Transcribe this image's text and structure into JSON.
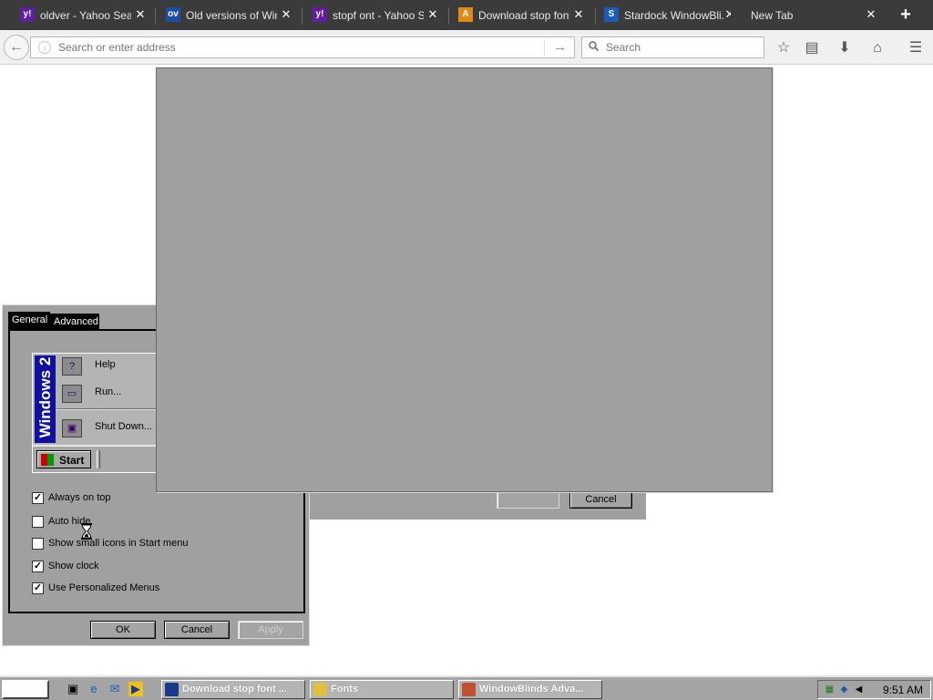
{
  "browser": {
    "tabs": [
      {
        "title": "oldver - Yahoo Sear...",
        "favicon": "yahoo-icon",
        "favicon_text": "y!",
        "favicon_color": "#5f1fa0"
      },
      {
        "title": "Old versions of Win...",
        "favicon": "oldversion-icon",
        "favicon_text": "ov",
        "favicon_color": "#1d4fa0"
      },
      {
        "title": "stopf ont - Yahoo S...",
        "favicon": "yahoo-icon",
        "favicon_text": "y!",
        "favicon_color": "#5f1fa0"
      },
      {
        "title": "Download stop font ...",
        "favicon": "download-icon",
        "favicon_text": "A",
        "favicon_color": "#e08a1a"
      },
      {
        "title": "Stardock WindowBli...",
        "favicon": "stardock-icon",
        "favicon_text": "S",
        "favicon_color": "#1a5bb8"
      },
      {
        "title": "New Tab",
        "favicon": "",
        "favicon_text": "",
        "favicon_color": ""
      }
    ],
    "url_placeholder": "Search or enter address",
    "search_placeholder": "Search",
    "colors": {
      "tab_strip": "#3b3b3b",
      "navbar": "#f0f0f0"
    }
  },
  "dialog": {
    "tabs": {
      "general": "General",
      "advanced": "Advanced"
    },
    "banner_text": "Windows 2",
    "start_menu": {
      "items": [
        {
          "label": "Help",
          "icon": "help-book-icon"
        },
        {
          "label": "Run...",
          "icon": "run-icon"
        },
        {
          "label": "Shut Down...",
          "icon": "shutdown-icon"
        }
      ],
      "start_label": "Start"
    },
    "options": [
      {
        "label": "Always on top",
        "checked": true
      },
      {
        "label": "Auto hide",
        "checked": false
      },
      {
        "label": "Show small icons in Start menu",
        "checked": false
      },
      {
        "label": "Show clock",
        "checked": true
      },
      {
        "label": "Use Personalized Menus",
        "checked": true
      }
    ],
    "buttons": {
      "ok": "OK",
      "cancel": "Cancel",
      "apply": "Apply"
    }
  },
  "dialog2": {
    "cancel": "Cancel"
  },
  "taskbar": {
    "tasks": [
      {
        "label": "Download stop font ...",
        "icon_color": "#1a3a8a"
      },
      {
        "label": "Fonts",
        "icon_color": "#e0c040"
      },
      {
        "label": "WindowBlinds Adva...",
        "icon_color": "#c05030"
      }
    ],
    "clock": "9:51 AM"
  }
}
